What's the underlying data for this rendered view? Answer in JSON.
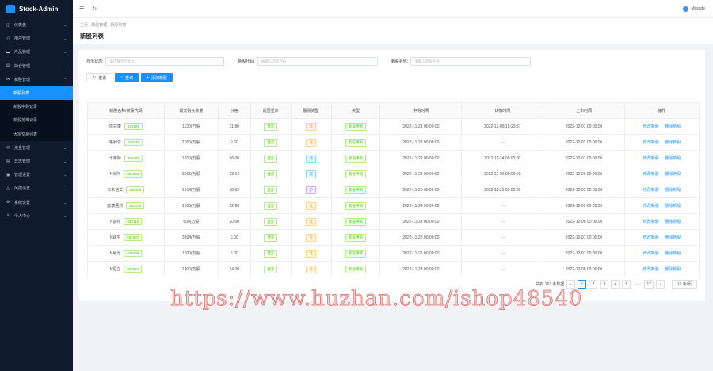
{
  "app": {
    "title": "Stock-Admin",
    "user": "Mitsade"
  },
  "sidebar": {
    "items": [
      {
        "label": "仪表盘",
        "icon": "dashboard-icon",
        "glyph": "◫"
      },
      {
        "label": "用户管理",
        "icon": "users-icon",
        "glyph": "⚇"
      },
      {
        "label": "产品管理",
        "icon": "product-icon",
        "glyph": "▬"
      },
      {
        "label": "持仓管理",
        "icon": "position-icon",
        "glyph": "▤"
      },
      {
        "label": "新股管理",
        "icon": "ipo-icon",
        "glyph": "⋈",
        "open": true
      }
    ],
    "sub": [
      {
        "label": "新股列表",
        "active": true
      },
      {
        "label": "新股申购记录"
      },
      {
        "label": "新股抢筹记录"
      },
      {
        "label": "大宗交易列表"
      }
    ],
    "items2": [
      {
        "label": "资金管理",
        "icon": "funds-icon",
        "glyph": "◎"
      },
      {
        "label": "日志管理",
        "icon": "log-icon",
        "glyph": "▤"
      },
      {
        "label": "管理设置",
        "icon": "admin-settings-icon",
        "glyph": "▣"
      },
      {
        "label": "风控设置",
        "icon": "risk-icon",
        "glyph": "△"
      },
      {
        "label": "系统设置",
        "icon": "system-settings-icon",
        "glyph": "⚙"
      },
      {
        "label": "个人中心",
        "icon": "profile-icon",
        "glyph": "♙"
      }
    ]
  },
  "breadcrumb": [
    "主页",
    "新股管理",
    "新股列表"
  ],
  "page_title": "新股列表",
  "filters": {
    "status_label": "显示状态:",
    "status_placeholder": "请选择显示状态",
    "code_label": "新股代码:",
    "code_placeholder": "请输入新股代码",
    "name_label": "新股名称:",
    "name_placeholder": "请输入新股名称"
  },
  "buttons": {
    "reset": "重置",
    "search": "查询",
    "add": "添加新股"
  },
  "table": {
    "columns": [
      "新股名称/新股代码",
      "最大购买数量",
      "价格",
      "是否显示",
      "股票类型",
      "类型",
      "申购时间",
      "认缴时间",
      "上市时间",
      "操作"
    ],
    "rows": [
      {
        "name": "億益康",
        "code": "870199",
        "qty": "1130(万股",
        "price": "31.80",
        "show": "显示",
        "stype": "北",
        "sc": "o",
        "type": "新股申购",
        "apply": "2022-11-21 00:00:00",
        "pay": "2022-12-08 19:23:37",
        "list": "2022-12-01 00:00:00"
      },
      {
        "name": "格利尔",
        "code": "831641",
        "qty": "1050(万股",
        "price": "9.60",
        "show": "显示",
        "stype": "北",
        "sc": "o",
        "type": "新股申购",
        "apply": "2022-11-21 00:00:00",
        "pay": "- -",
        "list": "2022-12-02 00:00:00"
      },
      {
        "name": "卡莱特",
        "code": "301391",
        "qty": "1700(万股",
        "price": "96.00",
        "show": "显示",
        "stype": "深",
        "sc": "b",
        "type": "新股申购",
        "apply": "2022-11-22 00:00:00",
        "pay": "2022-11-24 00:00:00",
        "list": "2022-12-01 00:00:00"
      },
      {
        "name": "N尚阿",
        "code": "001256",
        "qty": "3565(万股",
        "price": "13.64",
        "show": "显示",
        "stype": "深",
        "sc": "b",
        "type": "新股申购",
        "apply": "2022-11-22 00:00:00",
        "pay": "2022-12-06 00:00:00",
        "list": "2022-12-06 00:00:00"
      },
      {
        "name": "三未信安",
        "code": "688489",
        "qty": "1914(万股",
        "price": "78.89",
        "show": "显示",
        "stype": "沪",
        "sc": "p",
        "type": "新股申购",
        "apply": "2022-11-23 00:00:00",
        "pay": "2022-11-25 00:00:00",
        "list": "2022-12-02 00:00:00"
      },
      {
        "name": "欧康医药",
        "code": "833230",
        "qty": "1800(万股",
        "price": "12.80",
        "show": "显示",
        "stype": "北",
        "sc": "o",
        "type": "新股申购",
        "apply": "2022-11-24 00:00:00",
        "pay": "- -",
        "list": "2022-12-09 00:00:00"
      },
      {
        "name": "N富特",
        "code": "832116",
        "qty": "600(万股",
        "price": "20.00",
        "show": "显示",
        "stype": "北",
        "sc": "o",
        "type": "新股申购",
        "apply": "2022-11-24 00:00:00",
        "pay": "- -",
        "list": "2022-12-06 00:00:00"
      },
      {
        "name": "N联生",
        "code": "831087",
        "qty": "3304(万股",
        "price": "6.00",
        "show": "显示",
        "stype": "北",
        "sc": "o",
        "type": "新股申购",
        "apply": "2022-11-25 00:00:00",
        "pay": "- -",
        "list": "2022-12-07 00:00:00"
      },
      {
        "name": "N晨光",
        "code": "430300",
        "qty": "1500(万股",
        "price": "6.00",
        "show": "显示",
        "stype": "北",
        "sc": "o",
        "type": "新股申购",
        "apply": "2022-11-25 00:00:00",
        "pay": "- -",
        "list": "2022-12-07 00:00:00"
      },
      {
        "name": "N恒立",
        "code": "836942",
        "qty": "1400(万股",
        "price": "14.20",
        "show": "显示",
        "stype": "北",
        "sc": "o",
        "type": "新股申购",
        "apply": "2022-11-28 00:00:00",
        "pay": "- -",
        "list": "2022-12-08 00:00:00"
      }
    ],
    "edit_label": "修改新股",
    "delete_label": "删除新股"
  },
  "pagination": {
    "total": "共有 163 条数据",
    "pages": [
      "1",
      "2",
      "3",
      "4",
      "5"
    ],
    "ellipsis": "···",
    "last": "17",
    "size": "10 条/页",
    "current": 1
  },
  "watermark": "https://www.huzhan.com/ishop48540"
}
